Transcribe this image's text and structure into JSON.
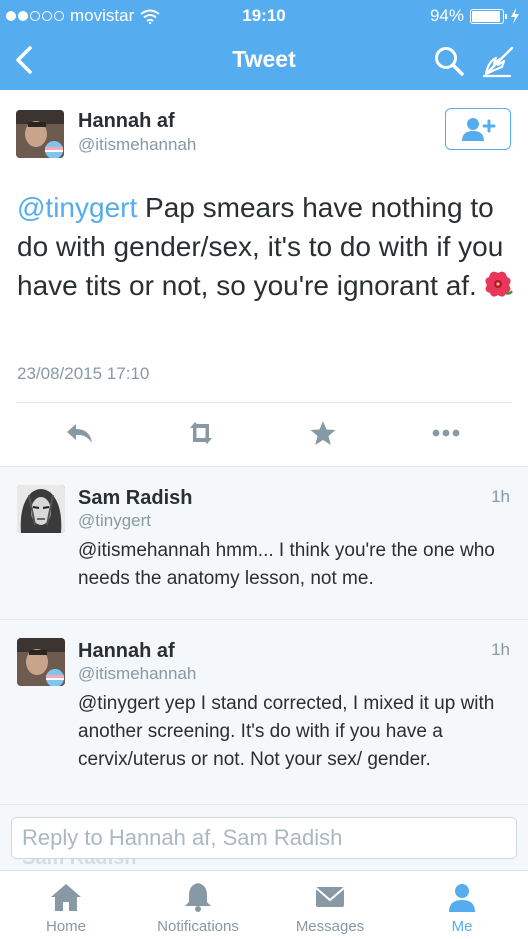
{
  "status_bar": {
    "carrier": "movistar",
    "time": "19:10",
    "battery": "94%",
    "battery_level": 0.94
  },
  "nav": {
    "title": "Tweet",
    "back_icon": "chevron-left-icon",
    "search_icon": "search-icon",
    "compose_icon": "compose-icon"
  },
  "main_tweet": {
    "author_name": "Hannah af",
    "author_handle": "@itismehannah",
    "mention": "@tinygert",
    "text": " Pap smears have nothing to do with gender/sex, it's to do with if you have tits or not, so you're ignorant af.",
    "emoji": "hibiscus",
    "date": "23/08/2015 17:10",
    "follow_icon": "add-user-icon",
    "actions": [
      "reply",
      "retweet",
      "favorite",
      "more"
    ]
  },
  "replies": [
    {
      "author_name": "Sam Radish",
      "author_handle": "@tinygert",
      "time": "1h",
      "text": "@itismehannah hmm... I think you're the one who needs the anatomy lesson, not me."
    },
    {
      "author_name": "Hannah af",
      "author_handle": "@itismehannah",
      "time": "1h",
      "text": "@tinygert yep I stand corrected, I mixed it up with another screening. It's do with if you have a cervix/uterus or not. Not your sex/ gender."
    }
  ],
  "reply_box": {
    "placeholder": "Reply to Hannah af, Sam Radish",
    "ghost_text": "Sam Radish"
  },
  "tabs": [
    {
      "label": "Home",
      "icon": "home-icon",
      "active": false
    },
    {
      "label": "Notifications",
      "icon": "bell-icon",
      "active": false
    },
    {
      "label": "Messages",
      "icon": "envelope-icon",
      "active": false
    },
    {
      "label": "Me",
      "icon": "person-icon",
      "active": true
    }
  ],
  "colors": {
    "brand": "#55acee",
    "text": "#292f33",
    "muted": "#8899a6"
  }
}
